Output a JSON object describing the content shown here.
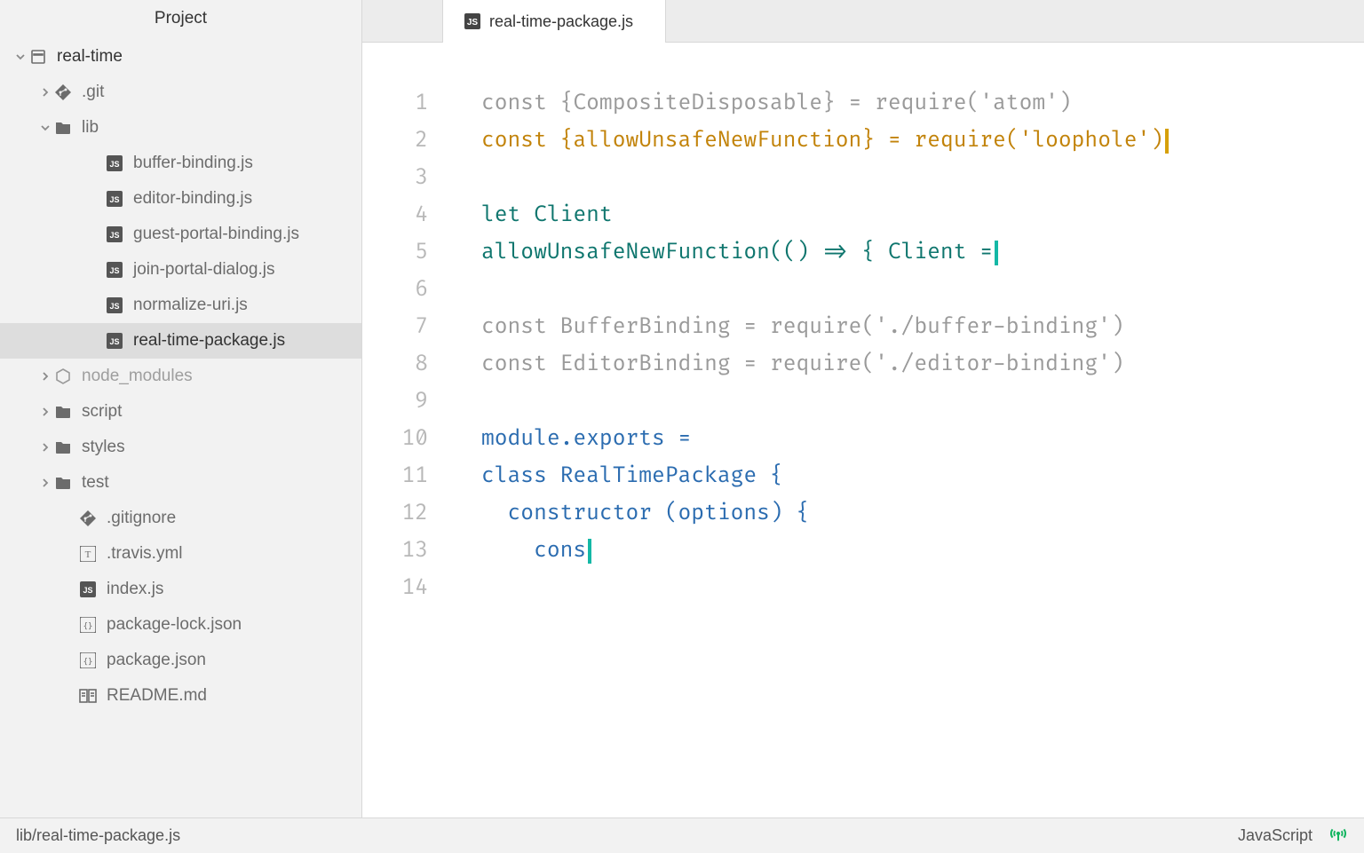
{
  "sidebar": {
    "title": "Project",
    "tree": [
      {
        "label": "real-time",
        "kind": "project",
        "depth": 0,
        "chevron": "down",
        "root": true
      },
      {
        "label": ".git",
        "kind": "git",
        "depth": 1,
        "chevron": "right"
      },
      {
        "label": "lib",
        "kind": "folder",
        "depth": 1,
        "chevron": "down"
      },
      {
        "label": "buffer-binding.js",
        "kind": "js",
        "depth": 3
      },
      {
        "label": "editor-binding.js",
        "kind": "js",
        "depth": 3
      },
      {
        "label": "guest-portal-binding.js",
        "kind": "js",
        "depth": 3
      },
      {
        "label": "join-portal-dialog.js",
        "kind": "js",
        "depth": 3
      },
      {
        "label": "normalize-uri.js",
        "kind": "js",
        "depth": 3
      },
      {
        "label": "real-time-package.js",
        "kind": "js",
        "depth": 3,
        "selected": true
      },
      {
        "label": "node_modules",
        "kind": "node",
        "depth": 1,
        "chevron": "right",
        "muted": true
      },
      {
        "label": "script",
        "kind": "folder",
        "depth": 1,
        "chevron": "right"
      },
      {
        "label": "styles",
        "kind": "folder",
        "depth": 1,
        "chevron": "right"
      },
      {
        "label": "test",
        "kind": "folder",
        "depth": 1,
        "chevron": "right"
      },
      {
        "label": ".gitignore",
        "kind": "gitignore",
        "depth": 2
      },
      {
        "label": ".travis.yml",
        "kind": "yml",
        "depth": 2
      },
      {
        "label": "index.js",
        "kind": "js",
        "depth": 2
      },
      {
        "label": "package-lock.json",
        "kind": "json",
        "depth": 2
      },
      {
        "label": "package.json",
        "kind": "json",
        "depth": 2
      },
      {
        "label": "README.md",
        "kind": "md",
        "depth": 2
      }
    ]
  },
  "tab": {
    "label": "real-time-package.js"
  },
  "code": {
    "lines": [
      [
        {
          "t": "const",
          "c": "k-gray"
        },
        {
          "t": " {CompositeDisposable} = ",
          "c": "k-gray"
        },
        {
          "t": "require",
          "c": "k-gray"
        },
        {
          "t": "(",
          "c": "k-gray"
        },
        {
          "t": "'atom'",
          "c": "k-gray"
        },
        {
          "t": ")",
          "c": "k-gray"
        }
      ],
      [
        {
          "t": "const",
          "c": "k-orange"
        },
        {
          "t": " {allowUnsafeNewFunction} = ",
          "c": "k-orange"
        },
        {
          "t": "require",
          "c": "k-orange"
        },
        {
          "t": "(",
          "c": "k-orange"
        },
        {
          "t": "'loophole'",
          "c": "k-orange"
        },
        {
          "t": ")",
          "c": "k-orange"
        },
        {
          "cursor": "orange"
        }
      ],
      [],
      [
        {
          "t": "let",
          "c": "k-teal"
        },
        {
          "t": " Client",
          "c": "k-teal"
        }
      ],
      [
        {
          "t": "allowUnsafeNewFunction(() => { Client =",
          "c": "k-teal"
        },
        {
          "cursor": "teal"
        }
      ],
      [],
      [
        {
          "t": "const",
          "c": "k-gray"
        },
        {
          "t": " BufferBinding = ",
          "c": "k-gray"
        },
        {
          "t": "require",
          "c": "k-gray"
        },
        {
          "t": "(",
          "c": "k-gray"
        },
        {
          "t": "'./buffer-binding'",
          "c": "k-gray"
        },
        {
          "t": ")",
          "c": "k-gray"
        }
      ],
      [
        {
          "t": "const",
          "c": "k-gray"
        },
        {
          "t": " EditorBinding = ",
          "c": "k-gray"
        },
        {
          "t": "require",
          "c": "k-gray"
        },
        {
          "t": "(",
          "c": "k-gray"
        },
        {
          "t": "'./editor-binding'",
          "c": "k-gray"
        },
        {
          "t": ")",
          "c": "k-gray"
        }
      ],
      [],
      [
        {
          "t": "module",
          "c": "k-blue"
        },
        {
          "t": ".exports = ",
          "c": "k-blue"
        }
      ],
      [
        {
          "t": "class",
          "c": "k-blue"
        },
        {
          "t": " RealTimePackage {",
          "c": "k-blue"
        }
      ],
      [
        {
          "t": "  constructor (options) {",
          "c": "k-blue"
        }
      ],
      [
        {
          "t": "    cons",
          "c": "k-blue"
        },
        {
          "cursor": "teal"
        }
      ],
      []
    ]
  },
  "status": {
    "path": "lib/real-time-package.js",
    "language": "JavaScript"
  }
}
